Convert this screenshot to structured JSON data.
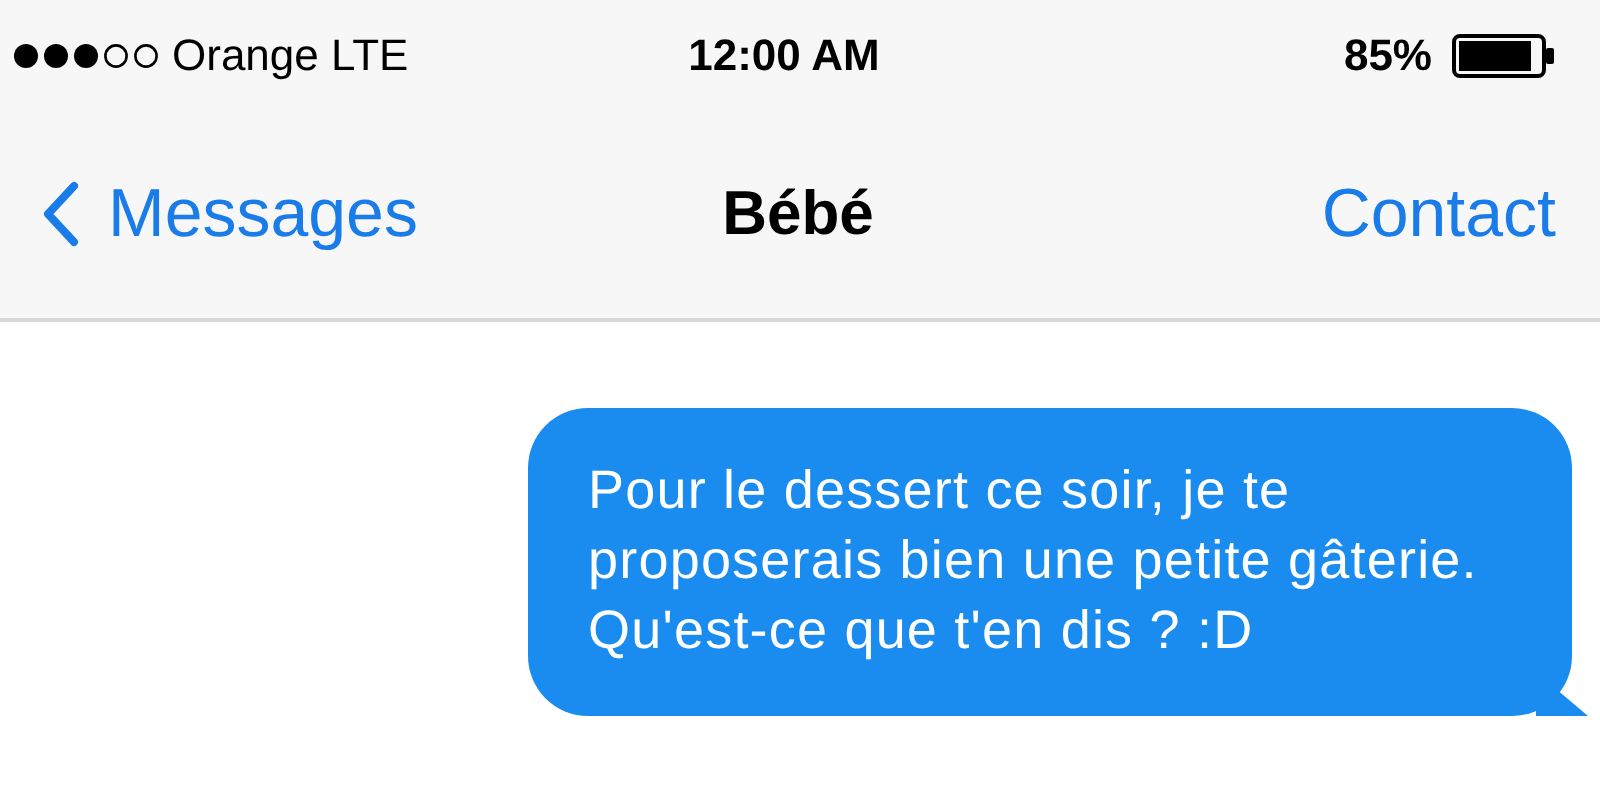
{
  "status_bar": {
    "carrier": "Orange LTE",
    "time": "12:00 AM",
    "battery": "85%"
  },
  "nav": {
    "back": "Messages",
    "title": "Bébé",
    "action": "Contact"
  },
  "messages": [
    {
      "kind": "sent",
      "text": "Pour le dessert ce soir, je te proposerais bien une petite gâterie. Qu'est-ce que t'en dis ? :D"
    }
  ]
}
